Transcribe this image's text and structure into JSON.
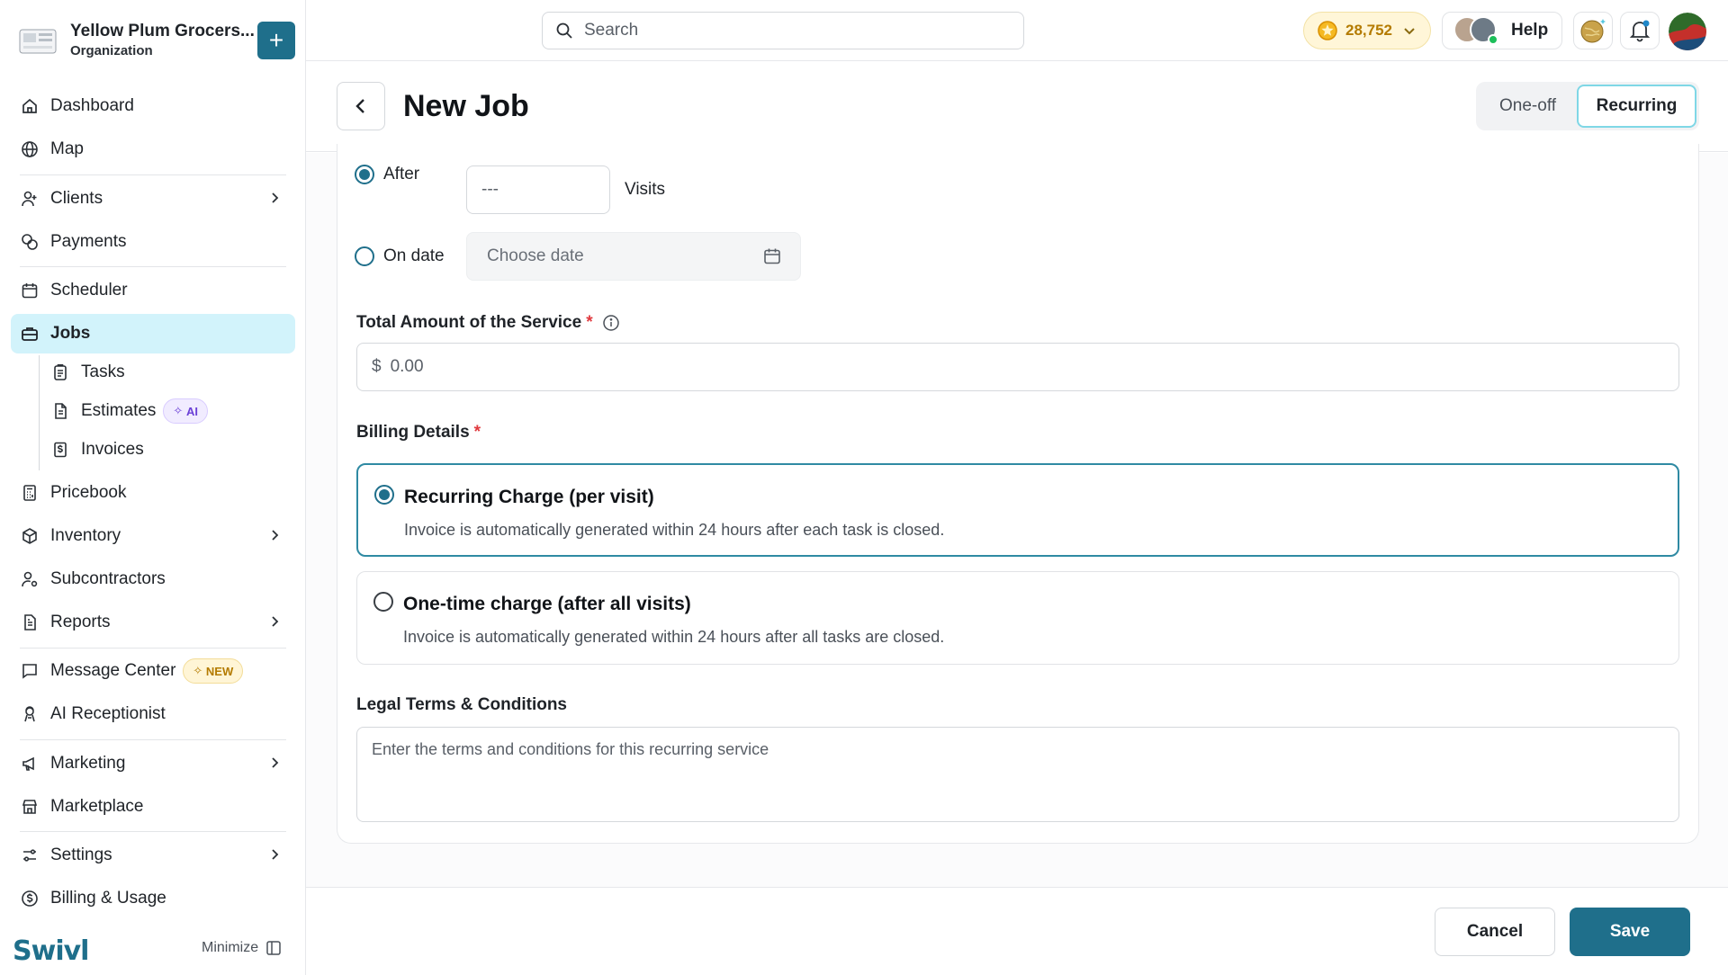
{
  "org": {
    "name": "Yellow Plum Grocers...",
    "type": "Organization",
    "add_label": "+"
  },
  "sidebar": {
    "items": [
      {
        "label": "Dashboard"
      },
      {
        "label": "Map"
      },
      {
        "label": "Clients"
      },
      {
        "label": "Payments"
      },
      {
        "label": "Scheduler"
      },
      {
        "label": "Jobs"
      },
      {
        "label": "Tasks"
      },
      {
        "label": "Estimates",
        "badge": "AI"
      },
      {
        "label": "Invoices"
      },
      {
        "label": "Pricebook"
      },
      {
        "label": "Inventory"
      },
      {
        "label": "Subcontractors"
      },
      {
        "label": "Reports"
      },
      {
        "label": "Message Center",
        "badge": "NEW"
      },
      {
        "label": "AI Receptionist"
      },
      {
        "label": "Marketing"
      },
      {
        "label": "Marketplace"
      },
      {
        "label": "Settings"
      },
      {
        "label": "Billing & Usage"
      }
    ],
    "active": "Jobs",
    "brand": "Swivl",
    "minimize_label": "Minimize"
  },
  "topbar": {
    "search_placeholder": "Search",
    "coins": "28,752",
    "help_label": "Help"
  },
  "header": {
    "title": "New Job",
    "tabs": [
      {
        "label": "One-off"
      },
      {
        "label": "Recurring"
      }
    ],
    "selected_tab": "Recurring"
  },
  "form": {
    "end": {
      "after_label": "After",
      "visits_value": "---",
      "visits_label": "Visits",
      "ondate_label": "On date",
      "date_placeholder": "Choose date",
      "selected": "After"
    },
    "total": {
      "label": "Total Amount of the Service",
      "required": "*",
      "currency": "$",
      "value": "0.00"
    },
    "billing": {
      "label": "Billing Details",
      "required": "*",
      "options": [
        {
          "title": "Recurring Charge (per visit)",
          "desc": "Invoice is automatically generated within 24 hours after each task is closed."
        },
        {
          "title": "One-time charge (after all visits)",
          "desc": "Invoice is automatically generated within 24 hours after all tasks are closed."
        }
      ],
      "selected": "Recurring Charge (per visit)"
    },
    "terms": {
      "label": "Legal Terms & Conditions",
      "placeholder": "Enter the terms and conditions for this recurring service",
      "value": ""
    }
  },
  "footer": {
    "cancel_label": "Cancel",
    "save_label": "Save"
  },
  "colors": {
    "accent": "#1f6f8b",
    "active_bg": "#d2f3fb",
    "required": "#e0393e",
    "coin": "#b47b00"
  }
}
